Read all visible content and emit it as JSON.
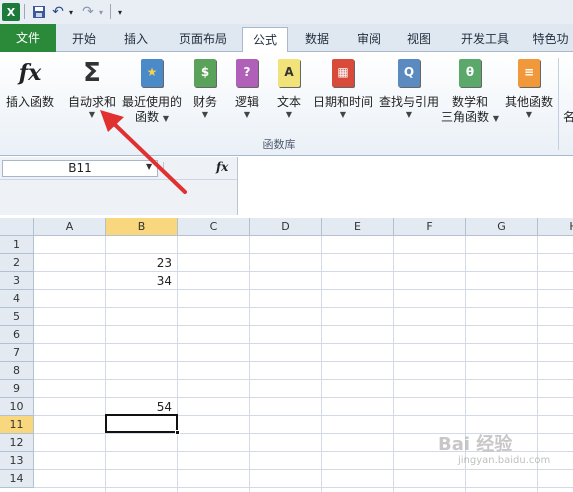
{
  "qat": {
    "logo": "X",
    "undo": "↶",
    "redo": "↷",
    "customize": "▾"
  },
  "tabs": [
    {
      "label": "文件"
    },
    {
      "label": "开始"
    },
    {
      "label": "插入"
    },
    {
      "label": "页面布局"
    },
    {
      "label": "公式"
    },
    {
      "label": "数据"
    },
    {
      "label": "审阅"
    },
    {
      "label": "视图"
    },
    {
      "label": "开发工具"
    },
    {
      "label": "特色功"
    }
  ],
  "ribbon": {
    "buttons": [
      {
        "label": "插入函数",
        "icon": "fx"
      },
      {
        "label": "自动求和",
        "icon": "Σ"
      },
      {
        "label": "最近使用的",
        "label2": "函数",
        "icon": "★"
      },
      {
        "label": "财务",
        "icon": "$"
      },
      {
        "label": "逻辑",
        "icon": "?"
      },
      {
        "label": "文本",
        "icon": "A"
      },
      {
        "label": "日期和时间",
        "icon": "▦"
      },
      {
        "label": "查找与引用",
        "icon": "Q"
      },
      {
        "label": "数学和",
        "label2": "三角函数",
        "icon": "θ"
      },
      {
        "label": "其他函数",
        "icon": "≡"
      }
    ],
    "group_label": "函数库",
    "right_cut": "名"
  },
  "formula_bar": {
    "name_box": "B11",
    "fx": "fx",
    "value": ""
  },
  "grid": {
    "columns": [
      "A",
      "B",
      "C",
      "D",
      "E",
      "F",
      "G",
      "H"
    ],
    "rows": [
      "1",
      "2",
      "3",
      "4",
      "5",
      "6",
      "7",
      "8",
      "9",
      "10",
      "11",
      "12",
      "13",
      "14"
    ],
    "selected_column": "B",
    "selected_row": "11",
    "cells": [
      {
        "ref": "B2",
        "value": "23"
      },
      {
        "ref": "B3",
        "value": "34"
      },
      {
        "ref": "B10",
        "value": "54"
      }
    ]
  },
  "watermark": {
    "text": "Bai 经验",
    "sub": "jingyan.baidu.com"
  },
  "colors": {
    "file_tab": "#2a8a3a",
    "selected_header": "#f9d77e",
    "arrow": "#e03030"
  }
}
